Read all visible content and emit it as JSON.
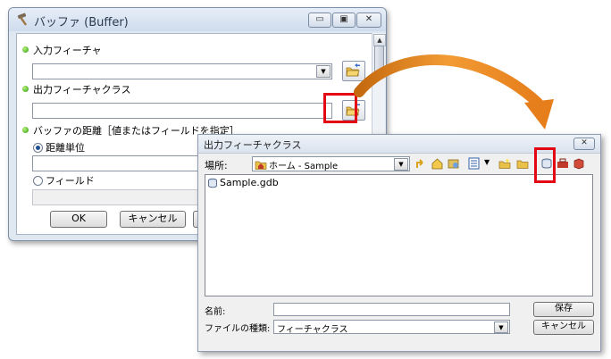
{
  "buffer_dialog": {
    "title": "バッファ (Buffer)",
    "controls": {
      "minimize": "▭",
      "maximize": "▣",
      "close": "✕"
    },
    "input_label": "入力フィーチャ",
    "input_value": "",
    "output_label": "出力フィーチャクラス",
    "output_value": "",
    "distance_label": "バッファの距離［値またはフィールドを指定］",
    "linear_unit_label": "距離単位",
    "field_label": "フィールド",
    "ok_label": "OK",
    "cancel_label": "キャンセル",
    "icons": [
      "hammer-icon",
      "folder-browse-icon",
      "bullet-icon"
    ]
  },
  "save_dialog": {
    "title": "出力フィーチャクラス",
    "location_label": "場所:",
    "location_value": "ホーム - Sample",
    "files": [
      {
        "name": "Sample.gdb",
        "icon": "geodatabase-icon"
      }
    ],
    "name_label": "名前:",
    "name_value": "",
    "type_label": "ファイルの種類:",
    "type_value": "フィーチャクラス",
    "save_label": "保存",
    "cancel_label": "キャンセル",
    "close_label": "✕"
  },
  "colors": {
    "highlight": "#e30613",
    "arrow": "#e8841a",
    "title_bg": "#dfe7f1",
    "bullet": "#2c9b14"
  }
}
